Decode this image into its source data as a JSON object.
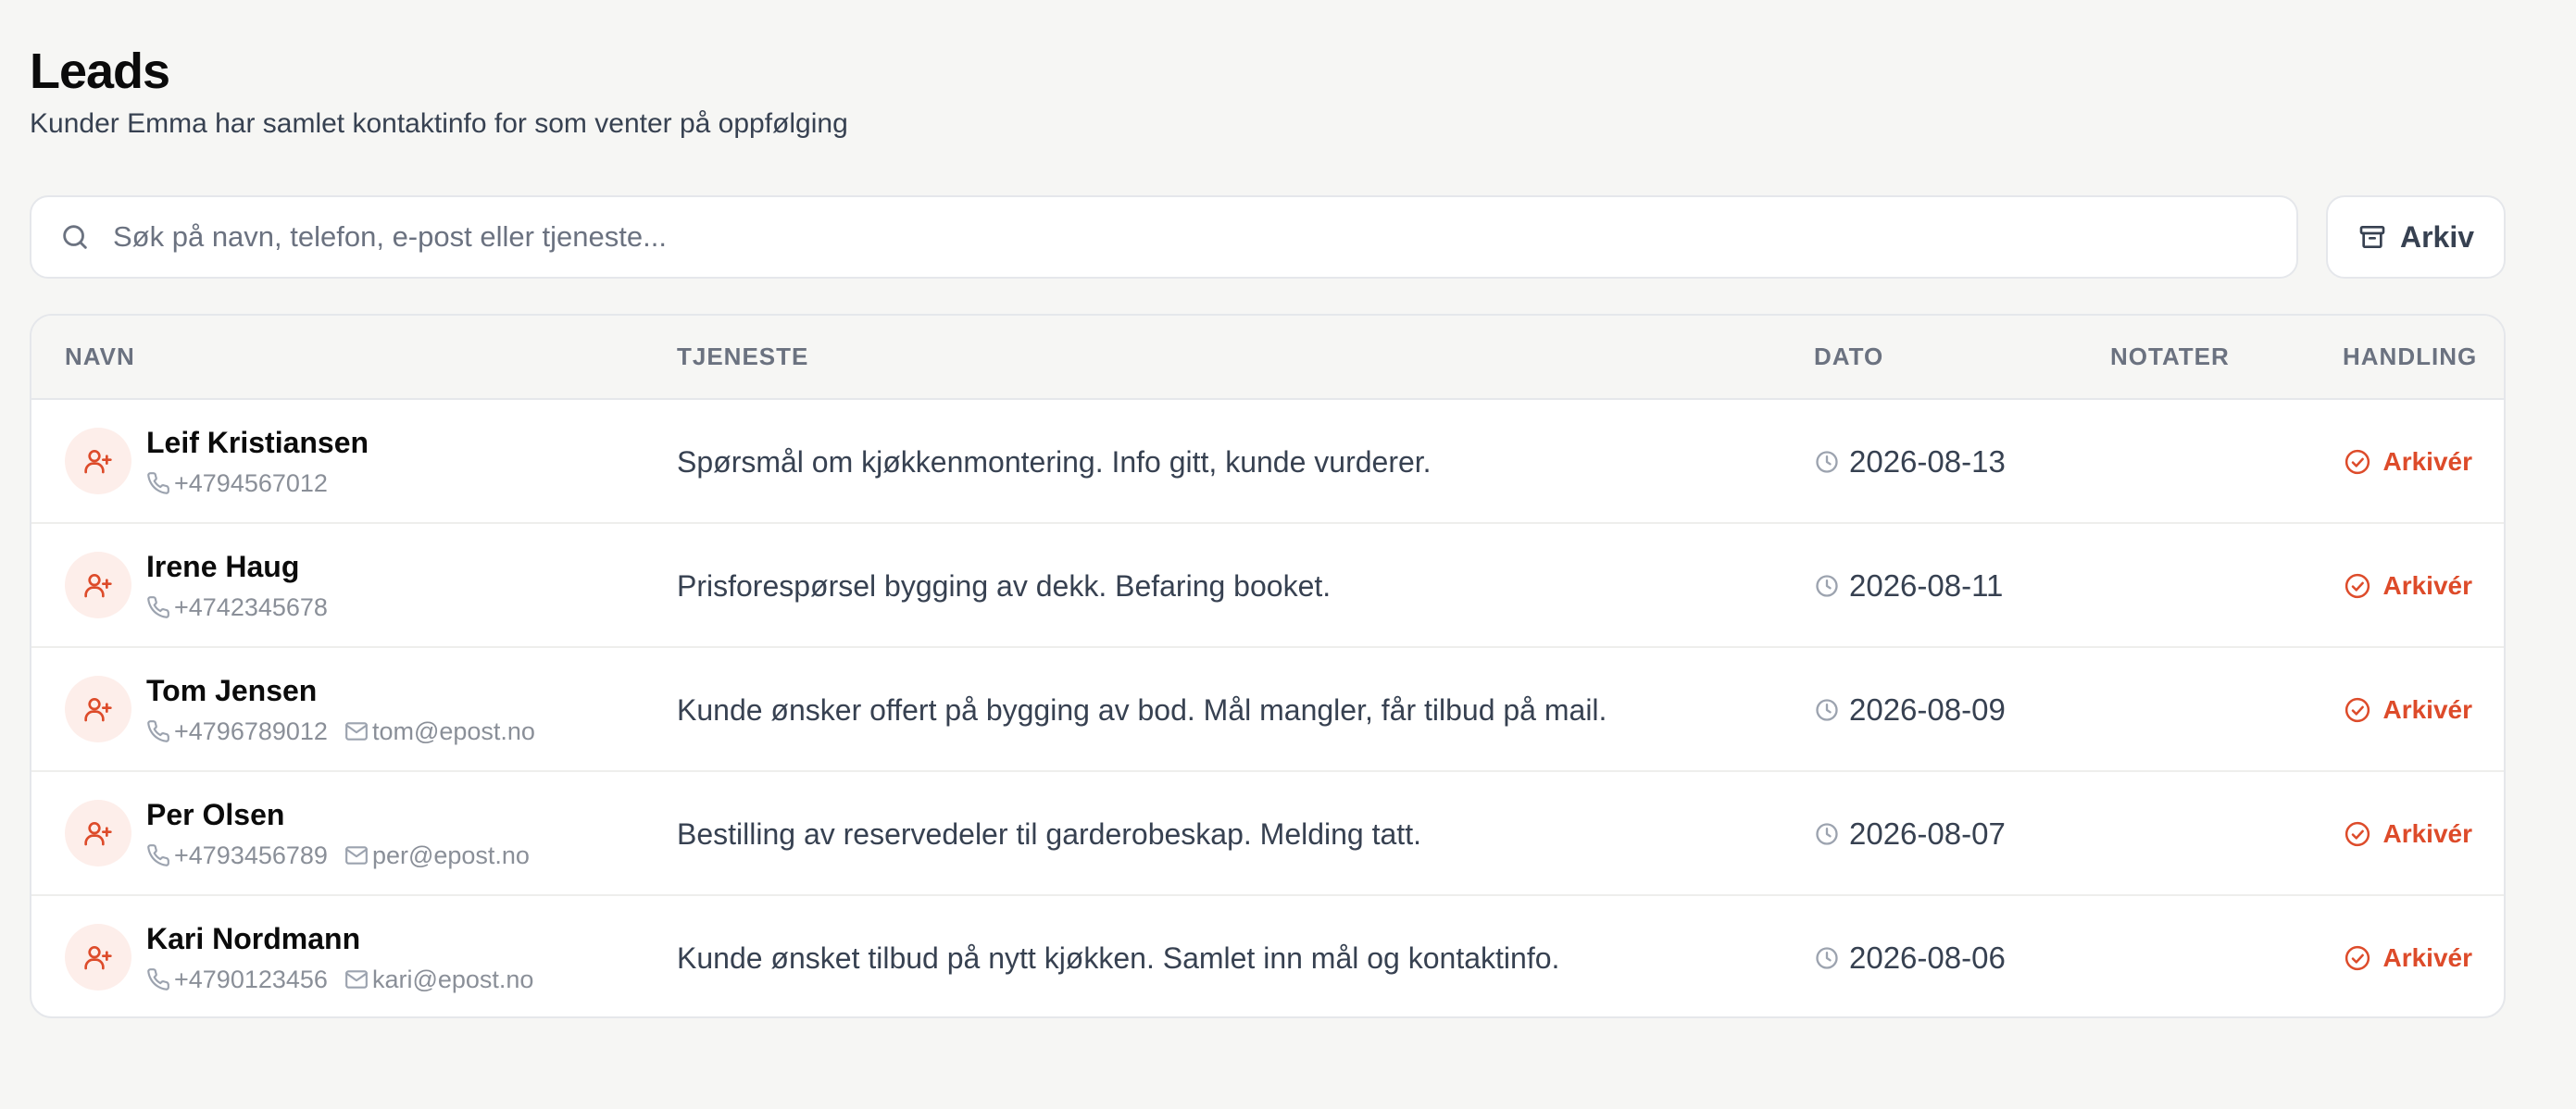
{
  "header": {
    "title": "Leads",
    "subtitle": "Kunder Emma har samlet kontaktinfo for som venter på oppfølging"
  },
  "search": {
    "placeholder": "Søk på navn, telefon, e-post eller tjeneste...",
    "value": ""
  },
  "toolbar": {
    "archive_label": "Arkiv"
  },
  "table": {
    "columns": [
      "NAVN",
      "TJENESTE",
      "DATO",
      "NOTATER",
      "HANDLING"
    ],
    "action_label": "Arkivér",
    "rows": [
      {
        "name": "Leif Kristiansen",
        "phone": "+4794567012",
        "email": "",
        "service": "Spørsmål om kjøkkenmontering. Info gitt, kunde vurderer.",
        "date": "2026-08-13",
        "notes": ""
      },
      {
        "name": "Irene Haug",
        "phone": "+4742345678",
        "email": "",
        "service": "Prisforespørsel bygging av dekk. Befaring booket.",
        "date": "2026-08-11",
        "notes": ""
      },
      {
        "name": "Tom Jensen",
        "phone": "+4796789012",
        "email": "tom@epost.no",
        "service": "Kunde ønsker offert på bygging av bod. Mål mangler, får tilbud på mail.",
        "date": "2026-08-09",
        "notes": ""
      },
      {
        "name": "Per Olsen",
        "phone": "+4793456789",
        "email": "per@epost.no",
        "service": "Bestilling av reservedeler til garderobeskap. Melding tatt.",
        "date": "2026-08-07",
        "notes": ""
      },
      {
        "name": "Kari Nordmann",
        "phone": "+4790123456",
        "email": "kari@epost.no",
        "service": "Kunde ønsket tilbud på nytt kjøkken. Samlet inn mål og kontaktinfo.",
        "date": "2026-08-06",
        "notes": ""
      }
    ]
  },
  "colors": {
    "accent": "#dd4b2a",
    "avatar_bg": "#fdeeea",
    "page_bg": "#f6f6f4"
  },
  "icons": {
    "search": "search-icon",
    "archive": "archive-box-icon",
    "avatar": "user-plus-icon",
    "phone": "phone-icon",
    "email": "mail-icon",
    "date": "clock-icon",
    "action": "check-circle-icon"
  }
}
